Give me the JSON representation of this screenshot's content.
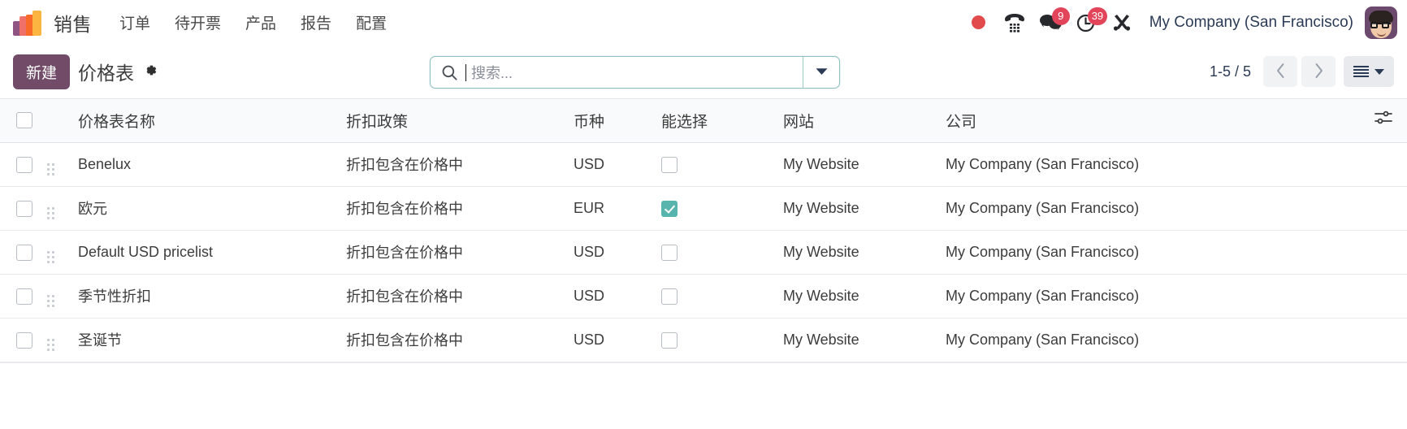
{
  "navbar": {
    "logo_name": "sales-app-logo",
    "app_name": "销售",
    "menu_items": [
      {
        "label": "订单",
        "name": "nav-item-orders"
      },
      {
        "label": "待开票",
        "name": "nav-item-to-invoice"
      },
      {
        "label": "产品",
        "name": "nav-item-products"
      },
      {
        "label": "报告",
        "name": "nav-item-reporting"
      },
      {
        "label": "配置",
        "name": "nav-item-configuration"
      }
    ],
    "systray": {
      "recording_indicator": "record-dot-icon",
      "phone_icon": "phone-dialpad-icon",
      "messages_icon": "chat-bubbles-icon",
      "messages_count": "9",
      "activities_icon": "clock-icon",
      "activities_count": "39",
      "tools_icon": "tools-icon"
    },
    "company": "My Company (San Francisco)",
    "avatar_name": "user-avatar"
  },
  "control_panel": {
    "new_button": "新建",
    "title": "价格表",
    "gear_icon": "gear-icon",
    "search": {
      "placeholder": "搜索...",
      "icon": "search-icon",
      "toggle_icon": "chevron-down-icon"
    },
    "pager": {
      "count": "1-5 / 5",
      "prev_icon": "chevron-left-icon",
      "next_icon": "chevron-right-icon"
    },
    "view_switcher": {
      "list_icon": "list-view-icon",
      "caret_icon": "caret-down-icon"
    }
  },
  "list": {
    "columns": [
      {
        "label": "价格表名称",
        "name": "column-pricelist-name"
      },
      {
        "label": "折扣政策",
        "name": "column-discount-policy"
      },
      {
        "label": "币种",
        "name": "column-currency"
      },
      {
        "label": "能选择",
        "name": "column-selectable"
      },
      {
        "label": "网站",
        "name": "column-website"
      },
      {
        "label": "公司",
        "name": "column-company"
      }
    ],
    "optional_columns_icon": "column-options-icon",
    "select_all_name": "select-all-checkbox",
    "rows": [
      {
        "name": "Benelux",
        "policy": "折扣包含在价格中",
        "currency": "USD",
        "selectable": false,
        "website": "My Website",
        "company": "My Company (San Francisco)"
      },
      {
        "name": "欧元",
        "policy": "折扣包含在价格中",
        "currency": "EUR",
        "selectable": true,
        "website": "My Website",
        "company": "My Company (San Francisco)"
      },
      {
        "name": "Default USD pricelist",
        "policy": "折扣包含在价格中",
        "currency": "USD",
        "selectable": false,
        "website": "My Website",
        "company": "My Company (San Francisco)"
      },
      {
        "name": "季节性折扣",
        "policy": "折扣包含在价格中",
        "currency": "USD",
        "selectable": false,
        "website": "My Website",
        "company": "My Company (San Francisco)"
      },
      {
        "name": "圣诞节",
        "policy": "折扣包含在价格中",
        "currency": "USD",
        "selectable": false,
        "website": "My Website",
        "company": "My Company (San Francisco)"
      }
    ]
  },
  "colors": {
    "brand_primary": "#714b67",
    "badge_red": "#e2455a",
    "checkbox_checked": "#58b5ad",
    "search_border": "#8fbfbf"
  }
}
